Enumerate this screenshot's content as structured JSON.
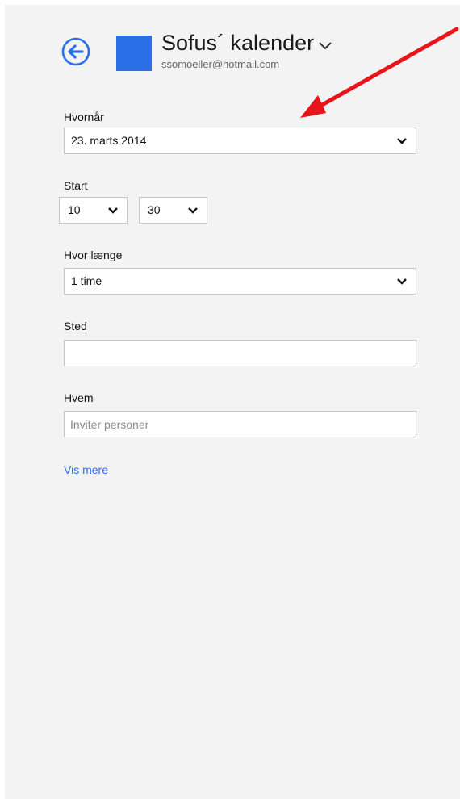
{
  "header": {
    "title": "Sofus´ kalender",
    "account": "ssomoeller@hotmail.com",
    "calendar_color": "#2b6fe6"
  },
  "form": {
    "when": {
      "label": "Hvornår",
      "value": "23. marts 2014"
    },
    "start": {
      "label": "Start",
      "hour": "10",
      "minute": "30"
    },
    "duration": {
      "label": "Hvor længe",
      "value": "1 time"
    },
    "location": {
      "label": "Sted",
      "value": ""
    },
    "who": {
      "label": "Hvem",
      "placeholder": "Inviter personer"
    },
    "show_more": "Vis mere"
  },
  "colors": {
    "accent": "#2b6fe6",
    "annotation_arrow": "#e8141a",
    "panel_background": "#f3f3f3"
  }
}
